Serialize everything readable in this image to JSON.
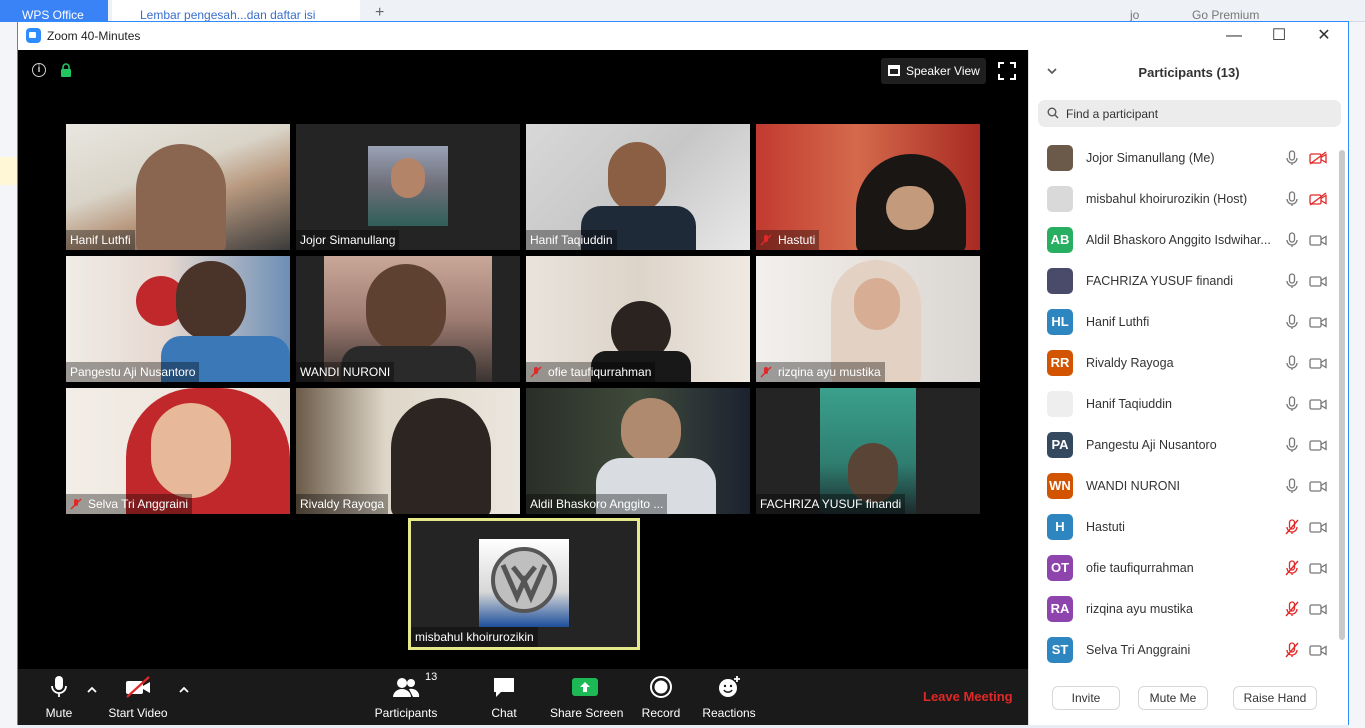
{
  "background_app": {
    "tab1_label": "WPS Office",
    "tab2_label": "Lembar pengesah...dan daftar isi",
    "user_initial": "J",
    "user_name": "jo",
    "premium_label": "Go Premium"
  },
  "window": {
    "title": "Zoom 40-Minutes"
  },
  "stage": {
    "speaker_view_label": "Speaker View"
  },
  "tiles": [
    {
      "name": "Hanif Luthfi",
      "muted": false
    },
    {
      "name": "Jojor Simanullang",
      "muted": false
    },
    {
      "name": "Hanif Taqiuddin",
      "muted": false
    },
    {
      "name": "Hastuti",
      "muted": true
    },
    {
      "name": "Pangestu Aji Nusantoro",
      "muted": false
    },
    {
      "name": "WANDI NURONI",
      "muted": false
    },
    {
      "name": "ofie taufiqurrahman",
      "muted": true
    },
    {
      "name": "rizqina ayu mustika",
      "muted": true
    },
    {
      "name": "Selva Tri Anggraini",
      "muted": true
    },
    {
      "name": "Rivaldy Rayoga",
      "muted": false
    },
    {
      "name": "Aldil Bhaskoro Anggito ...",
      "muted": false
    },
    {
      "name": "FACHRIZA YUSUF finandi",
      "muted": false
    },
    {
      "name": "misbahul khoirurozikin",
      "muted": false
    }
  ],
  "toolbar": {
    "mute_label": "Mute",
    "start_video_label": "Start Video",
    "participants_label": "Participants",
    "participants_count": "13",
    "chat_label": "Chat",
    "share_label": "Share Screen",
    "record_label": "Record",
    "reactions_label": "Reactions",
    "leave_label": "Leave Meeting"
  },
  "panel": {
    "title": "Participants (13)",
    "search_placeholder": "Find a participant",
    "participants": [
      {
        "name": "Jojor Simanullang (Me)",
        "initials": "",
        "color": "#6b5a4a",
        "mic_muted": false,
        "video_off": true
      },
      {
        "name": "misbahul khoirurozikin (Host)",
        "initials": "",
        "color": "#d9d9d9",
        "mic_muted": false,
        "video_off": true
      },
      {
        "name": "Aldil Bhaskoro Anggito Isdwihar...",
        "initials": "AB",
        "color": "#27ae60",
        "mic_muted": false,
        "video_off": false
      },
      {
        "name": "FACHRIZA YUSUF finandi",
        "initials": "",
        "color": "#4a4a6a",
        "mic_muted": false,
        "video_off": false
      },
      {
        "name": "Hanif Luthfi",
        "initials": "HL",
        "color": "#2e86c1",
        "mic_muted": false,
        "video_off": false
      },
      {
        "name": "Rivaldy Rayoga",
        "initials": "RR",
        "color": "#d35400",
        "mic_muted": false,
        "video_off": false
      },
      {
        "name": "Hanif Taqiuddin",
        "initials": "",
        "color": "#eeeeee",
        "mic_muted": false,
        "video_off": false
      },
      {
        "name": "Pangestu Aji Nusantoro",
        "initials": "PA",
        "color": "#34495e",
        "mic_muted": false,
        "video_off": false
      },
      {
        "name": "WANDI NURONI",
        "initials": "WN",
        "color": "#d35400",
        "mic_muted": false,
        "video_off": false
      },
      {
        "name": "Hastuti",
        "initials": "H",
        "color": "#2e86c1",
        "mic_muted": true,
        "video_off": false
      },
      {
        "name": "ofie taufiqurrahman",
        "initials": "OT",
        "color": "#8e44ad",
        "mic_muted": true,
        "video_off": false
      },
      {
        "name": "rizqina ayu mustika",
        "initials": "RA",
        "color": "#8e44ad",
        "mic_muted": true,
        "video_off": false
      },
      {
        "name": "Selva Tri Anggraini",
        "initials": "ST",
        "color": "#2e86c1",
        "mic_muted": true,
        "video_off": false
      }
    ],
    "invite_label": "Invite",
    "mute_me_label": "Mute Me",
    "raise_hand_label": "Raise Hand"
  },
  "colors": {
    "zoom_blue": "#2d8cff",
    "leave_red": "#e02828",
    "share_green": "#1db954",
    "active_speaker": "#e6e98a"
  }
}
